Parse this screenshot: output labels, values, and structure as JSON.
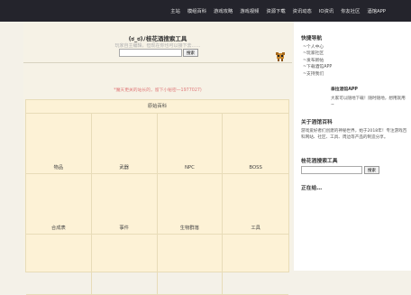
{
  "topnav": {
    "items": [
      "主站",
      "模组百科",
      "游戏攻略",
      "游戏视频",
      "资源下载",
      "资讯动态",
      "IO资讯",
      "你友社区",
      "酒馆APP"
    ]
  },
  "main": {
    "title": "(ಠ_ಠ)ﾉ桂花酒搜索工具",
    "subtitle": "玩家自主编辑，但现在你也可以接下去……",
    "search": {
      "placeholder": "",
      "button_label": "搜索"
    },
    "notice": "*魔天更关的站长的，留下小秘密一1977027)",
    "category_box": {
      "title": "原始百科",
      "cells": [
        "物品",
        "武器",
        "NPC",
        "BOSS",
        "合成表",
        "事件",
        "生物群落",
        "工具",
        "",
        "",
        "",
        ""
      ]
    }
  },
  "sidebar": {
    "nav_title": "快捷导航",
    "nav_links": [
      "~个人中心",
      "~玩家社区",
      "~发布新帖",
      "~下载酒馆APP",
      "~支持我们"
    ],
    "app_title": "泰拉酒馆APP",
    "app_desc": "大家可以随地下载！随时随地，想用就用~",
    "about_title": "关于酒馆百科",
    "about_desc": "游戏爱好者们创建的神秘世界，始于2018年！专注游戏百科网站、社区、工具、周边等产品的制造分享。",
    "search_title": "桂花酒搜索工具",
    "search_button": "搜索",
    "loading": "正在给…"
  },
  "colors": {
    "topbar": "#24242c",
    "page_bg": "#f4f1e8",
    "notice": "#e07b7b",
    "grid_bg": "#fdf2d6"
  }
}
